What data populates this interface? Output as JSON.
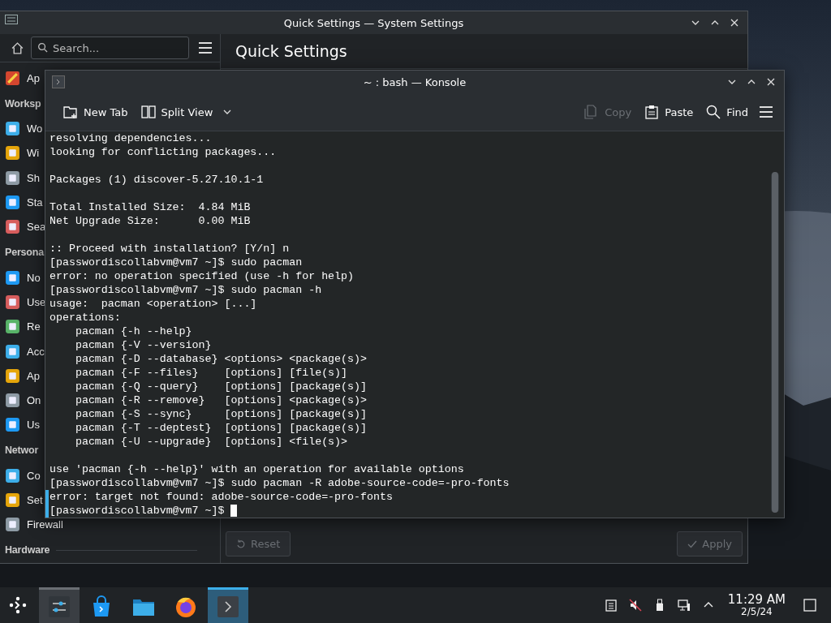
{
  "settings_window": {
    "title": "Quick Settings — System Settings",
    "search": {
      "placeholder": "Search..."
    },
    "page_title": "Quick Settings",
    "sidebar": {
      "top_items": [
        "Ap"
      ],
      "sections": [
        {
          "title": "Worksp",
          "items": [
            "Wo",
            "Wi",
            "Sh",
            "Sta",
            "Sea"
          ]
        },
        {
          "title": "Persona",
          "items": [
            "No",
            "Use",
            "Re",
            "Acc",
            "Ap",
            "On",
            "Us"
          ]
        },
        {
          "title": "Networ",
          "items": [
            "Co",
            "Set",
            "Firewall"
          ]
        },
        {
          "title": "Hardware"
        }
      ]
    },
    "footer_buttons": [
      {
        "label": "Reset",
        "kind": "reset",
        "disabled": true
      },
      {
        "label": "Apply",
        "kind": "apply",
        "disabled": true
      }
    ]
  },
  "konsole": {
    "title": "~ : bash — Konsole",
    "toolbar": [
      {
        "label": "New Tab",
        "kind": "new-tab",
        "disabled": false
      },
      {
        "label": "Split View",
        "kind": "split",
        "disabled": false
      },
      {
        "label": "Copy",
        "kind": "copy",
        "disabled": true
      },
      {
        "label": "Paste",
        "kind": "paste",
        "disabled": false
      },
      {
        "label": "Find",
        "kind": "find",
        "disabled": false
      }
    ],
    "blocks": [
      [
        {
          "text": "resolving dependencies...",
          "marked": false
        },
        {
          "text": "looking for conflicting packages...",
          "marked": false
        }
      ],
      [
        {
          "text": "Packages (1) discover-5.27.10.1-1",
          "marked": false
        }
      ],
      [
        {
          "text": "Total Installed Size:  4.84 MiB",
          "marked": false
        },
        {
          "text": "Net Upgrade Size:      0.00 MiB",
          "marked": false
        }
      ],
      [
        {
          "text": ":: Proceed with installation? [Y/n] n",
          "marked": false
        },
        {
          "text": "[passwordiscollabvm@vm7 ~]$ sudo pacman",
          "marked": false
        },
        {
          "text": "error: no operation specified (use -h for help)",
          "marked": false
        },
        {
          "text": "[passwordiscollabvm@vm7 ~]$ sudo pacman -h",
          "marked": false
        },
        {
          "text": "usage:  pacman <operation> [...]",
          "marked": false
        },
        {
          "text": "operations:",
          "marked": false
        },
        {
          "text": "    pacman {-h --help}",
          "marked": false
        },
        {
          "text": "    pacman {-V --version}",
          "marked": false
        },
        {
          "text": "    pacman {-D --database} <options> <package(s)>",
          "marked": false
        },
        {
          "text": "    pacman {-F --files}    [options] [file(s)]",
          "marked": false
        },
        {
          "text": "    pacman {-Q --query}    [options] [package(s)]",
          "marked": false
        },
        {
          "text": "    pacman {-R --remove}   [options] <package(s)>",
          "marked": false
        },
        {
          "text": "    pacman {-S --sync}     [options] [package(s)]",
          "marked": false
        },
        {
          "text": "    pacman {-T --deptest}  [options] [package(s)]",
          "marked": false
        },
        {
          "text": "    pacman {-U --upgrade}  [options] <file(s)>",
          "marked": false
        }
      ],
      [
        {
          "text": "use 'pacman {-h --help}' with an operation for available options",
          "marked": false
        },
        {
          "text": "[passwordiscollabvm@vm7 ~]$ sudo pacman -R adobe-source-code=-pro-fonts",
          "marked": false
        },
        {
          "text": "error: target not found: adobe-source-code=-pro-fonts",
          "marked": true
        },
        {
          "text": "[passwordiscollabvm@vm7 ~]$ ",
          "marked": true
        }
      ]
    ]
  },
  "taskbar": {
    "tasks": [
      {
        "kind": "settings",
        "open": true,
        "selected": false
      },
      {
        "kind": "store",
        "open": false,
        "selected": false
      },
      {
        "kind": "folder",
        "open": false,
        "selected": false
      },
      {
        "kind": "browser",
        "open": false,
        "selected": false
      },
      {
        "kind": "terminal",
        "open": true,
        "selected": true
      }
    ],
    "time": "11:29 AM",
    "date": "2/5/24"
  }
}
